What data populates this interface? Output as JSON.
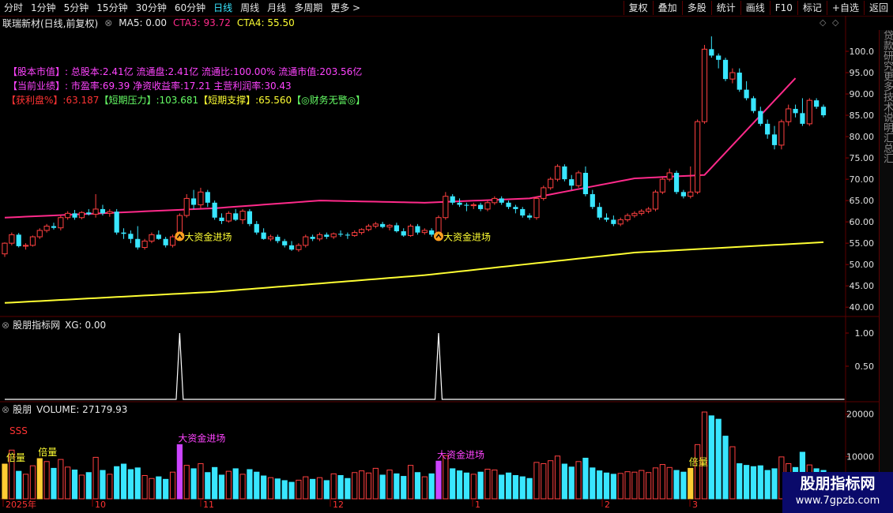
{
  "toolbar": {
    "periods": [
      "分时",
      "1分钟",
      "5分钟",
      "15分钟",
      "30分钟",
      "60分钟",
      "日线",
      "周线",
      "月线",
      "多周期",
      "更多 >"
    ],
    "active_index": 6,
    "right_buttons": [
      "复权",
      "叠加",
      "多股",
      "统计",
      "画线",
      "F10",
      "标记",
      "+自选",
      "返回"
    ]
  },
  "title": {
    "stock": "联瑞新材(日线,前复权)",
    "ma5": "MA5: 0.00",
    "cta3": "CTA3: 93.72",
    "cta4": "CTA4: 55.50"
  },
  "info_lines": {
    "line1_label": "【股本市值】:",
    "line1_text": "总股本:2.41亿 流通盘:2.41亿 流通比:100.00% 流通市值:203.56亿",
    "line2_label": "【当前业绩】:",
    "line2_text": "市盈率:69.39 净资收益率:17.21 主营利润率:30.43",
    "line3_a": "【获利盘%】:63.187",
    "line3_b": "【短期压力】:103.681",
    "line3_c": "【短期支撑】:65.560",
    "line3_d": "【◎财务无警◎】"
  },
  "main_axis": [
    "100.0",
    "95.00",
    "90.00",
    "85.00",
    "80.00",
    "75.00",
    "70.00",
    "65.00",
    "60.00",
    "55.00",
    "50.00",
    "45.00",
    "40.00"
  ],
  "signals": [
    "大资金进场",
    "大资金进场"
  ],
  "indicator_panel": {
    "label": "股朋指标网",
    "value": "XG: 0.00",
    "axis": [
      "1.00",
      "0.50"
    ]
  },
  "volume_panel": {
    "label": "股朋",
    "value": "VOLUME: 27179.93",
    "sss": "SSS",
    "axis": [
      "20000",
      "10000"
    ],
    "tags": [
      "倍量",
      "倍量",
      "大资金进场",
      "大资金进场",
      "倍量"
    ]
  },
  "date_axis": [
    "2025年",
    "10",
    "11",
    "12",
    "1",
    "2",
    "3"
  ],
  "right_strip_text": "贷款研究更多技术说明汇总汇",
  "watermark": {
    "title": "股朋指标网",
    "url": "www.7gpzb.com"
  },
  "colors": {
    "up": "#ff4040",
    "down": "#39e6ff",
    "ma_pink": "#ff2a8a",
    "ma_yellow": "#ffff33",
    "label_magenta": "#ff44ff",
    "green": "#66ff66",
    "yellow": "#ffff33"
  },
  "chart_data": [
    {
      "type": "candlestick",
      "title": "联瑞新材(日线,前复权)",
      "ylim": [
        38,
        105
      ],
      "ticks": [
        40,
        45,
        50,
        55,
        60,
        65,
        70,
        75,
        80,
        85,
        90,
        95,
        100
      ],
      "candles": [
        [
          52.5,
          55.2,
          51.8,
          55.0
        ],
        [
          55.0,
          57.5,
          54.5,
          57.0
        ],
        [
          57.0,
          57.4,
          54.0,
          54.3
        ],
        [
          54.3,
          55.0,
          53.5,
          54.5
        ],
        [
          54.5,
          56.8,
          54.2,
          56.5
        ],
        [
          56.5,
          58.5,
          56.0,
          58.0
        ],
        [
          58.0,
          59.5,
          57.5,
          59.0
        ],
        [
          59.0,
          59.8,
          58.2,
          58.6
        ],
        [
          58.6,
          61.5,
          58.0,
          61.0
        ],
        [
          61.0,
          62.5,
          60.5,
          62.0
        ],
        [
          62.0,
          62.8,
          60.5,
          61.0
        ],
        [
          61.0,
          62.5,
          60.6,
          62.2
        ],
        [
          62.2,
          63.0,
          61.5,
          61.8
        ],
        [
          61.8,
          66.5,
          61.0,
          63.0
        ],
        [
          63.0,
          64.0,
          61.5,
          62.0
        ],
        [
          62.0,
          63.0,
          61.2,
          62.4
        ],
        [
          62.4,
          63.0,
          57.0,
          57.5
        ],
        [
          57.5,
          58.5,
          56.0,
          57.2
        ],
        [
          57.2,
          58.0,
          55.0,
          56.0
        ],
        [
          56.0,
          59.0,
          53.5,
          54.0
        ],
        [
          54.0,
          56.0,
          53.5,
          55.5
        ],
        [
          55.5,
          57.5,
          55.0,
          57.0
        ],
        [
          57.0,
          58.0,
          55.8,
          56.0
        ],
        [
          56.0,
          56.5,
          54.0,
          54.5
        ],
        [
          54.5,
          57.0,
          54.0,
          56.5
        ],
        [
          56.5,
          62.0,
          56.0,
          61.5
        ],
        [
          61.5,
          66.5,
          61.0,
          65.5
        ],
        [
          65.5,
          67.5,
          63.0,
          64.0
        ],
        [
          64.0,
          68.0,
          63.2,
          67.0
        ],
        [
          67.0,
          67.5,
          63.5,
          64.5
        ],
        [
          64.5,
          65.0,
          60.5,
          61.0
        ],
        [
          61.0,
          62.0,
          59.5,
          60.2
        ],
        [
          60.2,
          62.5,
          59.8,
          62.0
        ],
        [
          62.0,
          63.0,
          60.2,
          60.5
        ],
        [
          60.5,
          63.0,
          59.5,
          62.5
        ],
        [
          62.5,
          63.0,
          59.0,
          59.5
        ],
        [
          59.5,
          60.2,
          57.0,
          57.5
        ],
        [
          57.5,
          58.5,
          55.8,
          56.0
        ],
        [
          56.0,
          57.0,
          55.5,
          56.5
        ],
        [
          56.5,
          57.0,
          55.0,
          55.5
        ],
        [
          55.5,
          56.0,
          54.0,
          54.5
        ],
        [
          54.5,
          55.5,
          53.2,
          53.5
        ],
        [
          53.5,
          55.0,
          53.0,
          54.5
        ],
        [
          54.5,
          57.0,
          54.0,
          56.5
        ],
        [
          56.5,
          57.0,
          55.5,
          56.0
        ],
        [
          56.0,
          57.5,
          55.5,
          57.0
        ],
        [
          57.0,
          57.5,
          56.0,
          56.5
        ],
        [
          56.5,
          57.5,
          56.0,
          57.2
        ],
        [
          57.2,
          58.0,
          56.5,
          57.0
        ],
        [
          57.0,
          57.5,
          56.0,
          56.8
        ],
        [
          56.8,
          58.0,
          56.5,
          57.5
        ],
        [
          57.5,
          58.5,
          57.0,
          58.2
        ],
        [
          58.2,
          59.5,
          57.8,
          59.0
        ],
        [
          59.0,
          60.0,
          58.5,
          59.5
        ],
        [
          59.5,
          60.0,
          58.5,
          58.8
        ],
        [
          58.8,
          59.5,
          58.0,
          59.2
        ],
        [
          59.2,
          59.8,
          57.5,
          57.8
        ],
        [
          57.8,
          58.5,
          56.5,
          56.8
        ],
        [
          56.8,
          59.5,
          56.5,
          59.0
        ],
        [
          59.0,
          59.5,
          57.0,
          57.5
        ],
        [
          57.5,
          58.5,
          57.0,
          58.0
        ],
        [
          58.0,
          58.5,
          56.5,
          57.0
        ],
        [
          57.0,
          61.5,
          56.5,
          61.0
        ],
        [
          61.0,
          67.0,
          60.5,
          66.0
        ],
        [
          66.0,
          66.5,
          64.0,
          64.5
        ],
        [
          64.5,
          65.5,
          63.5,
          64.0
        ],
        [
          64.0,
          64.5,
          62.5,
          63.8
        ],
        [
          63.8,
          64.5,
          63.0,
          64.0
        ],
        [
          64.0,
          64.5,
          62.5,
          63.0
        ],
        [
          63.0,
          65.0,
          62.5,
          64.5
        ],
        [
          64.5,
          66.0,
          64.0,
          65.5
        ],
        [
          65.5,
          66.0,
          64.0,
          64.5
        ],
        [
          64.5,
          65.0,
          63.0,
          63.5
        ],
        [
          63.5,
          64.0,
          62.0,
          63.0
        ],
        [
          63.0,
          63.5,
          61.0,
          61.5
        ],
        [
          61.5,
          62.0,
          60.5,
          61.0
        ],
        [
          61.0,
          66.0,
          60.5,
          65.5
        ],
        [
          65.5,
          68.5,
          65.0,
          68.0
        ],
        [
          68.0,
          70.5,
          67.5,
          70.0
        ],
        [
          70.0,
          73.5,
          69.5,
          73.0
        ],
        [
          73.0,
          73.5,
          69.5,
          70.0
        ],
        [
          70.0,
          71.0,
          67.5,
          68.5
        ],
        [
          68.5,
          72.0,
          68.0,
          71.5
        ],
        [
          71.5,
          73.0,
          66.0,
          66.5
        ],
        [
          66.5,
          67.5,
          63.0,
          63.5
        ],
        [
          63.5,
          64.5,
          60.5,
          61.0
        ],
        [
          61.0,
          62.0,
          60.0,
          60.5
        ],
        [
          60.5,
          61.5,
          59.0,
          59.5
        ],
        [
          59.5,
          61.0,
          59.0,
          60.5
        ],
        [
          60.5,
          62.0,
          60.0,
          61.5
        ],
        [
          61.5,
          62.5,
          61.0,
          62.0
        ],
        [
          62.0,
          63.0,
          61.5,
          62.5
        ],
        [
          62.5,
          63.5,
          62.0,
          63.0
        ],
        [
          63.0,
          67.5,
          62.5,
          67.0
        ],
        [
          67.0,
          70.5,
          66.5,
          70.0
        ],
        [
          70.0,
          72.5,
          69.5,
          71.5
        ],
        [
          71.5,
          72.0,
          66.5,
          67.0
        ],
        [
          67.0,
          67.5,
          65.5,
          66.0
        ],
        [
          66.0,
          73.0,
          65.5,
          67.0
        ],
        [
          67.0,
          84.0,
          66.5,
          83.5
        ],
        [
          83.5,
          101.5,
          83.0,
          100.5
        ],
        [
          100.5,
          103.5,
          98.5,
          99.0
        ],
        [
          99.0,
          99.5,
          96.0,
          98.0
        ],
        [
          98.0,
          98.5,
          93.0,
          93.5
        ],
        [
          93.5,
          96.0,
          92.5,
          95.0
        ],
        [
          95.0,
          96.0,
          90.5,
          91.0
        ],
        [
          91.0,
          93.0,
          88.5,
          89.0
        ],
        [
          89.0,
          89.5,
          85.5,
          86.0
        ],
        [
          86.0,
          87.0,
          82.5,
          83.0
        ],
        [
          83.0,
          84.0,
          79.5,
          80.5
        ],
        [
          80.5,
          82.5,
          77.0,
          78.0
        ],
        [
          78.0,
          84.0,
          77.0,
          83.5
        ],
        [
          83.5,
          87.5,
          82.5,
          86.5
        ],
        [
          86.5,
          87.5,
          84.5,
          85.5
        ],
        [
          85.5,
          89.0,
          82.5,
          83.0
        ],
        [
          83.0,
          89.0,
          82.5,
          88.5
        ],
        [
          88.5,
          89.0,
          86.5,
          87.0
        ],
        [
          87.0,
          87.5,
          84.5,
          85.0
        ]
      ]
    },
    {
      "type": "line",
      "series": [
        {
          "name": "XG",
          "values": [
            0,
            0,
            0,
            0,
            0,
            0,
            0,
            0,
            0,
            0,
            0,
            0,
            0,
            0,
            0,
            0,
            0,
            0,
            0,
            0,
            0,
            0,
            0,
            0,
            0,
            1,
            0,
            0,
            0,
            0,
            0,
            0,
            0,
            0,
            0,
            0,
            0,
            0,
            0,
            0,
            0,
            0,
            0,
            0,
            0,
            0,
            0,
            0,
            0,
            0,
            0,
            0,
            0,
            0,
            0,
            0,
            0,
            0,
            0,
            0,
            0,
            0,
            1,
            0,
            0,
            0,
            0,
            0,
            0,
            0,
            0,
            0,
            0,
            0,
            0,
            0,
            0,
            0,
            0,
            0,
            0,
            0,
            0,
            0,
            0,
            0,
            0,
            0,
            0,
            0,
            0,
            0,
            0,
            0,
            0,
            0,
            0,
            0,
            0,
            0,
            0,
            0,
            0,
            0,
            0,
            0,
            0,
            0,
            0,
            0,
            0,
            0,
            0,
            0,
            0,
            0,
            0,
            0,
            0,
            0,
            0
          ]
        }
      ],
      "ylim": [
        0,
        1.2
      ]
    },
    {
      "type": "bar",
      "title": "VOLUME",
      "ylim": [
        0,
        22000
      ],
      "values": [
        8200,
        11500,
        6500,
        5800,
        7800,
        9500,
        8800,
        7200,
        9300,
        7500,
        6800,
        5600,
        6200,
        9800,
        6700,
        5800,
        7600,
        8200,
        6900,
        7300,
        5500,
        4800,
        5200,
        4600,
        6300,
        12800,
        7900,
        7100,
        8300,
        6200,
        7400,
        5600,
        6500,
        7100,
        5800,
        6900,
        6300,
        5400,
        5000,
        4700,
        4300,
        3900,
        4400,
        5200,
        4600,
        5000,
        4300,
        5900,
        5500,
        4800,
        6200,
        6600,
        6100,
        7200,
        5600,
        6800,
        5900,
        5300,
        7900,
        6200,
        5200,
        5900,
        8900,
        10200,
        7100,
        6600,
        6100,
        5800,
        6300,
        7000,
        6800,
        5600,
        6100,
        5500,
        5200,
        4800,
        8600,
        8300,
        9000,
        10100,
        8200,
        7500,
        8800,
        9600,
        7300,
        6600,
        6100,
        5800,
        6000,
        6400,
        6300,
        6700,
        6200,
        7300,
        8100,
        7400,
        6700,
        6300,
        7200,
        12800,
        20500,
        19600,
        18800,
        14800,
        12300,
        8300,
        7900,
        7600,
        7800,
        6700,
        7100,
        9900,
        8300,
        7400,
        11000,
        8000,
        7100,
        6700
      ],
      "up": [
        1,
        1,
        0,
        1,
        1,
        1,
        1,
        0,
        1,
        1,
        0,
        1,
        0,
        1,
        0,
        1,
        0,
        0,
        0,
        0,
        1,
        1,
        0,
        0,
        1,
        1,
        1,
        0,
        1,
        0,
        0,
        0,
        1,
        0,
        1,
        0,
        0,
        0,
        1,
        0,
        0,
        0,
        1,
        1,
        0,
        1,
        0,
        1,
        0,
        0,
        1,
        1,
        1,
        1,
        0,
        1,
        0,
        0,
        1,
        0,
        1,
        0,
        1,
        1,
        0,
        0,
        0,
        1,
        0,
        1,
        1,
        0,
        0,
        0,
        0,
        0,
        1,
        1,
        1,
        1,
        0,
        0,
        1,
        0,
        0,
        0,
        0,
        0,
        1,
        1,
        1,
        1,
        1,
        1,
        1,
        1,
        0,
        0,
        1,
        1,
        1,
        0,
        0,
        0,
        1,
        0,
        0,
        0,
        0,
        0,
        0,
        1,
        1,
        0,
        0,
        1,
        0,
        0
      ]
    }
  ]
}
